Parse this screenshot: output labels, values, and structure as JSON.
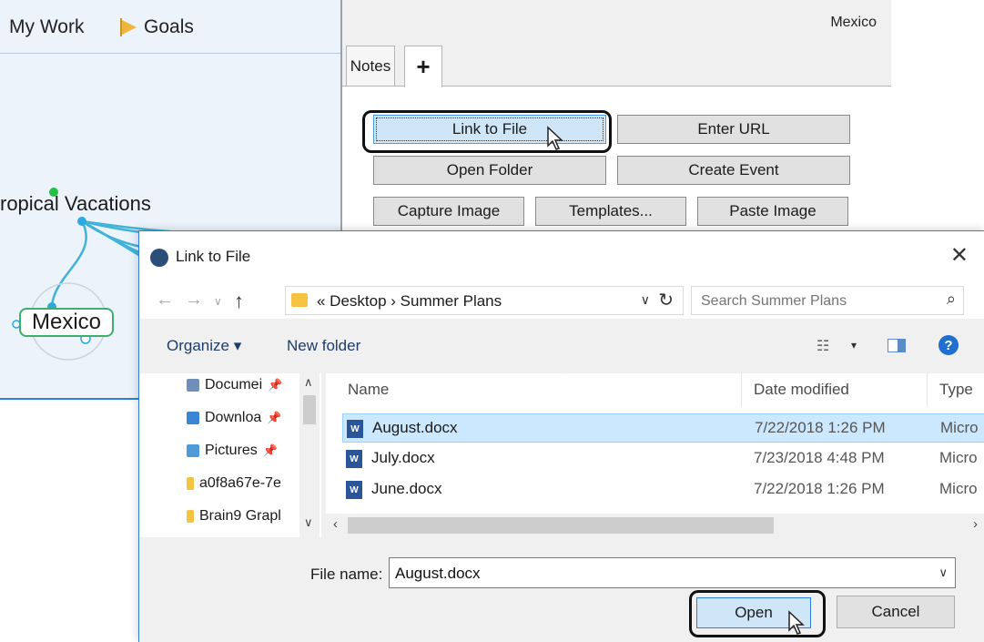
{
  "plex": {
    "path": [
      "My Work",
      "Goals"
    ],
    "thoughts": {
      "parent": "ropical Vacations",
      "active": "Mexico"
    }
  },
  "notes": {
    "title": "Mexico",
    "tabs": [
      "Notes",
      "+"
    ],
    "buttons": {
      "link_to_file": "Link to File",
      "enter_url": "Enter URL",
      "open_folder": "Open Folder",
      "create_event": "Create Event",
      "capture_image": "Capture Image",
      "templates": "Templates...",
      "paste_image": "Paste Image"
    }
  },
  "dialog": {
    "title": "Link to File",
    "close_glyph": "✕",
    "nav": {
      "back": "←",
      "forward": "→",
      "recent": "∨",
      "up": "↑",
      "breadcrumb": "«  Desktop  ›  Summer Plans",
      "search_placeholder": "Search Summer Plans"
    },
    "commands": {
      "organize": "Organize ▾",
      "new_folder": "New folder"
    },
    "tree": [
      {
        "label": "Documei",
        "icon": "documents-icon",
        "color": "#6f8fb8"
      },
      {
        "label": "Downloa",
        "icon": "downloads-icon",
        "color": "#3a86d4"
      },
      {
        "label": "Pictures",
        "icon": "pictures-icon",
        "color": "#4f9bd9"
      },
      {
        "label": "a0f8a67e-7e",
        "icon": "folder-icon",
        "color": "#f5c342"
      },
      {
        "label": "Brain9 Grapl",
        "icon": "folder-icon",
        "color": "#f5c342"
      }
    ],
    "columns": {
      "name": "Name",
      "date": "Date modified",
      "type": "Type"
    },
    "files": [
      {
        "name": "August.docx",
        "date": "7/22/2018 1:26 PM",
        "type": "Micro",
        "selected": true
      },
      {
        "name": "July.docx",
        "date": "7/23/2018 4:48 PM",
        "type": "Micro",
        "selected": false
      },
      {
        "name": "June.docx",
        "date": "7/22/2018 1:26 PM",
        "type": "Micro",
        "selected": false
      }
    ],
    "filename_label": "File name:",
    "filename_value": "August.docx",
    "open_label": "Open",
    "cancel_label": "Cancel"
  },
  "colors": {
    "accent": "#2f7fd6",
    "selection": "#cce8ff",
    "thought_border": "#3fae6b",
    "link_line": "#41b3d9"
  }
}
